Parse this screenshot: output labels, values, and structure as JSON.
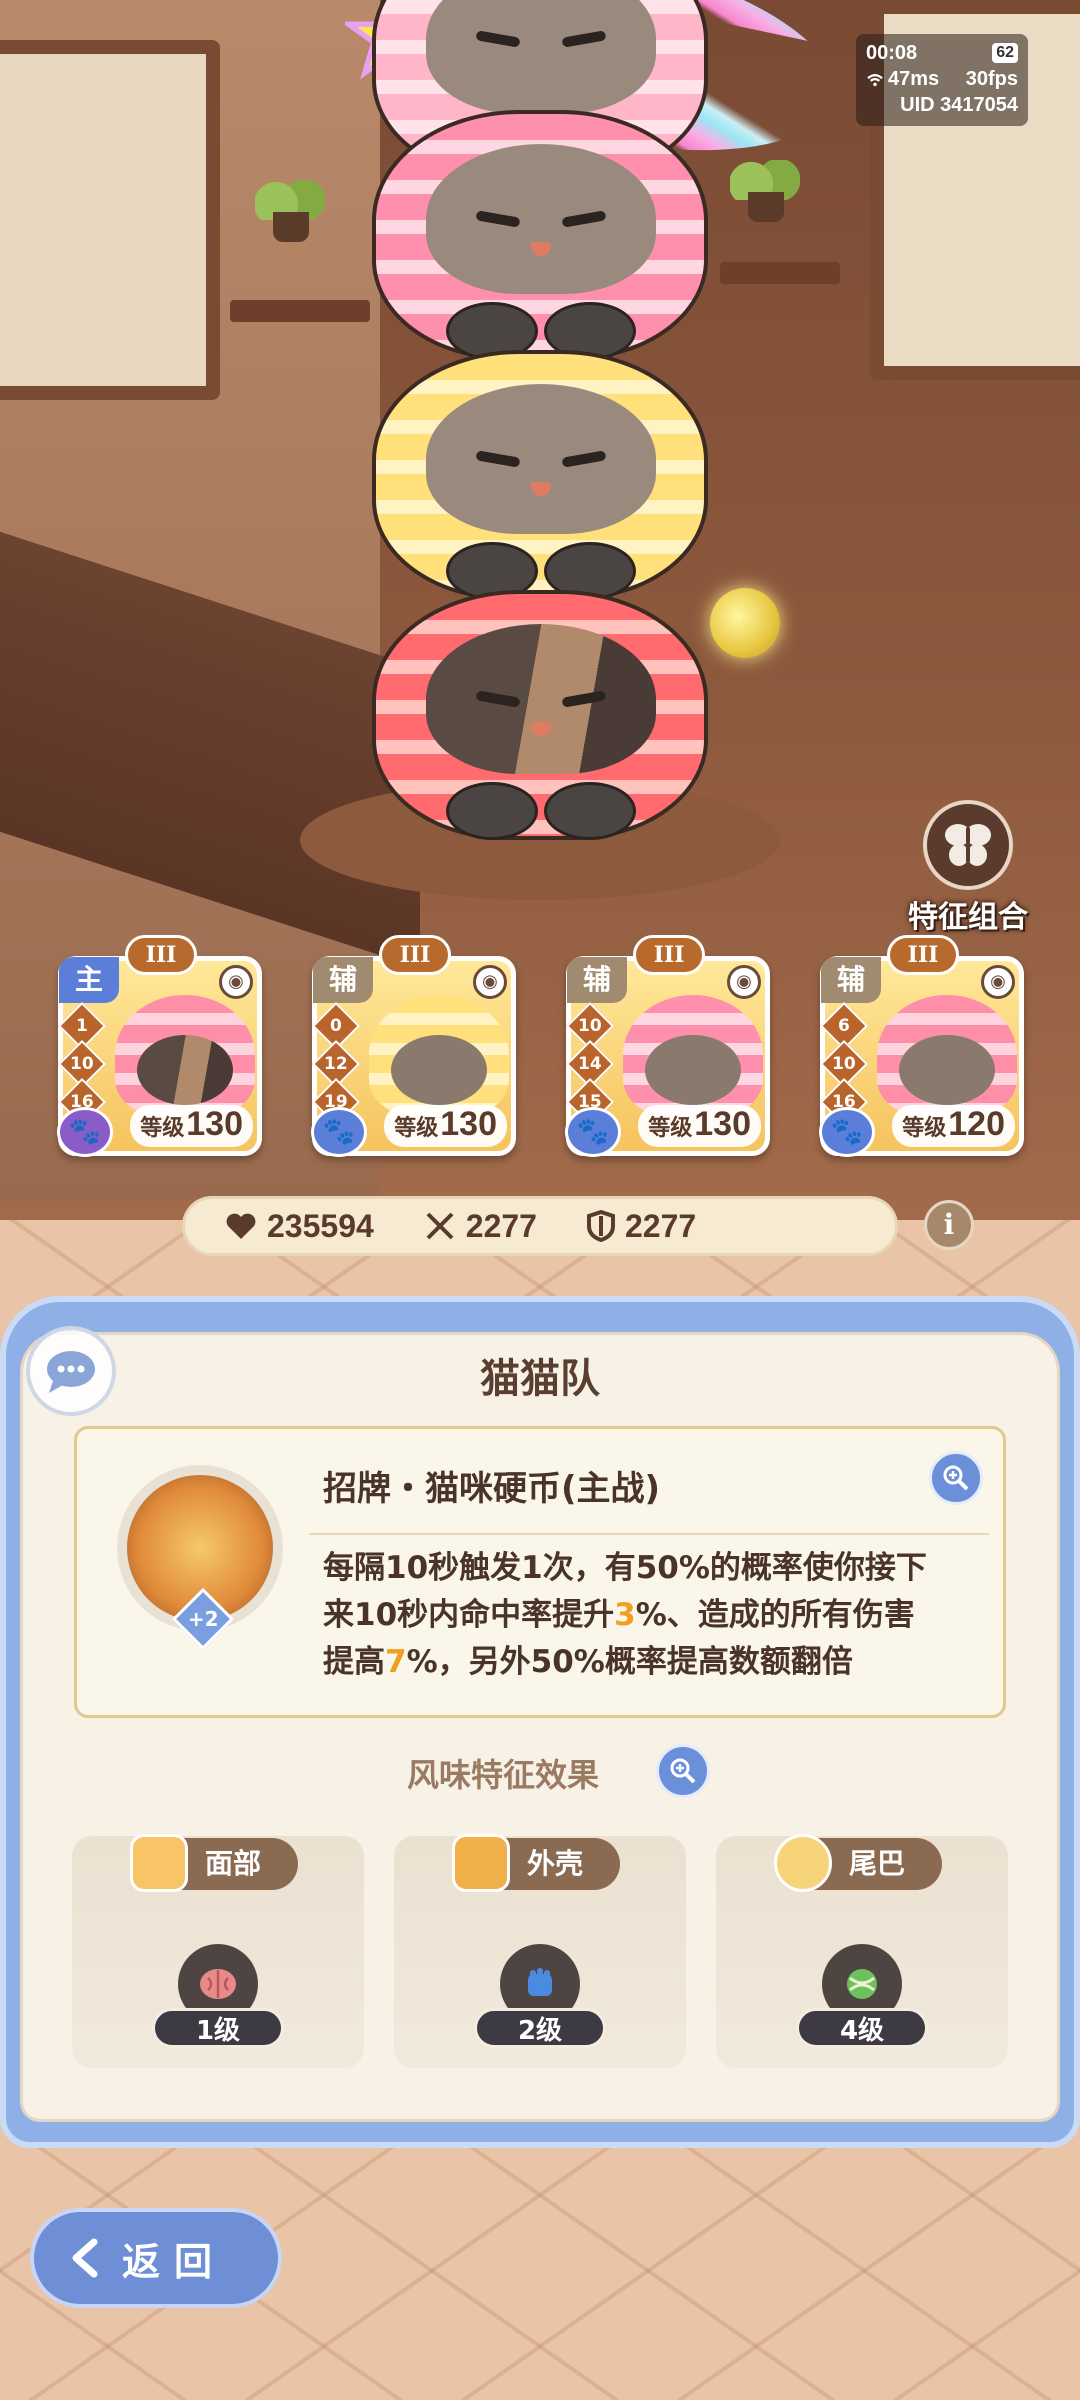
{
  "status": {
    "time": "00:08",
    "battery": "62",
    "ping": "47ms",
    "fps": "30fps",
    "uid": "UID 3417054"
  },
  "trait_combo": {
    "label": "特征组合",
    "icon": "butterfly-icon"
  },
  "cards": [
    {
      "role": "主",
      "tier": "III",
      "ranks": [
        "1",
        "10",
        "16"
      ],
      "level_label": "等级",
      "level": "130",
      "paw_color": "#8a5cc8"
    },
    {
      "role": "辅",
      "tier": "III",
      "ranks": [
        "0",
        "12",
        "19"
      ],
      "level_label": "等级",
      "level": "130",
      "paw_color": "#5b7fd8"
    },
    {
      "role": "辅",
      "tier": "III",
      "ranks": [
        "10",
        "14",
        "15"
      ],
      "level_label": "等级",
      "level": "130",
      "paw_color": "#5b7fd8"
    },
    {
      "role": "辅",
      "tier": "III",
      "ranks": [
        "6",
        "10",
        "16"
      ],
      "level_label": "等级",
      "level": "120",
      "paw_color": "#5b7fd8"
    }
  ],
  "stats": {
    "hp": "235594",
    "attack": "2277",
    "defense": "2277"
  },
  "panel": {
    "title": "猫猫队",
    "skill": {
      "name": "招牌・猫咪硬币(主战)",
      "badge": "+2",
      "desc_1": "每隔10秒触发1次，有50%的概率使你接下",
      "desc_2a": "来10秒内命中率提升",
      "desc_2b": "3",
      "desc_2c": "%、造成的所有伤害",
      "desc_3a": "提高",
      "desc_3b": "7",
      "desc_3c": "%，另外50%概率提高数额翻倍"
    },
    "flavor_title": "风味特征效果",
    "traits": [
      {
        "label": "面部",
        "level": "1级",
        "icon": "brain-icon"
      },
      {
        "label": "外壳",
        "level": "2级",
        "icon": "fist-icon"
      },
      {
        "label": "尾巴",
        "level": "4级",
        "icon": "leaf-ball-icon"
      }
    ]
  },
  "back_button": {
    "label": "返回"
  },
  "colors": {
    "accent_blue": "#6c8fda",
    "highlight_orange": "#f0a020",
    "panel_text": "#4a3428"
  }
}
